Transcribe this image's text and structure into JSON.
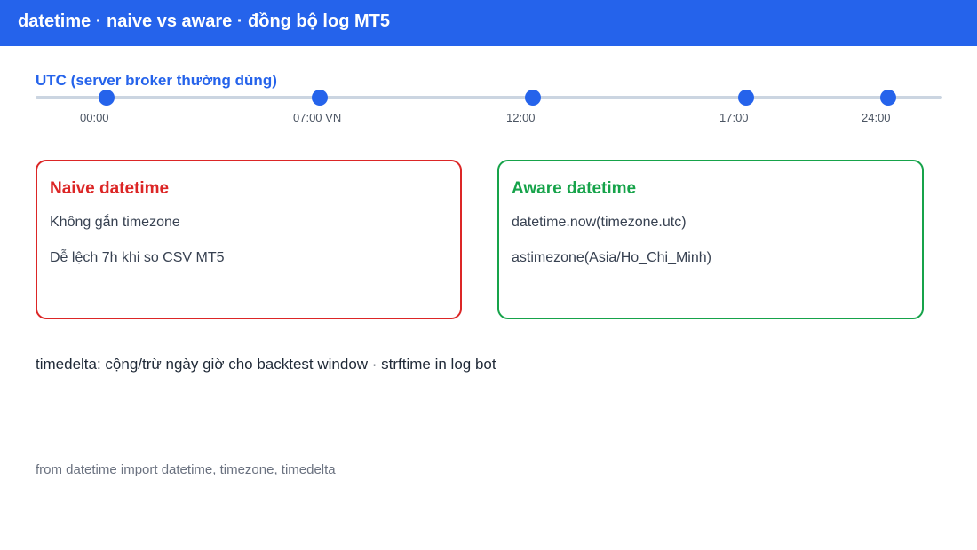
{
  "header": {
    "title": "datetime · naive vs aware · đồng bộ log MT5"
  },
  "timeline": {
    "title": "UTC (server broker thường dùng)",
    "ticks": [
      {
        "label": "00:00"
      },
      {
        "label": "07:00 VN"
      },
      {
        "label": "12:00"
      },
      {
        "label": "17:00"
      },
      {
        "label": "24:00"
      }
    ],
    "accent_color": "#2563eb"
  },
  "cards": {
    "naive": {
      "title": "Naive datetime",
      "lines": [
        "Không gắn timezone",
        "Dễ lệch 7h khi so CSV MT5"
      ],
      "color": "#dc2626"
    },
    "aware": {
      "title": "Aware datetime",
      "lines": [
        "datetime.now(timezone.utc)",
        "astimezone(Asia/Ho_Chi_Minh)"
      ],
      "color": "#16a34a"
    }
  },
  "summary": "timedelta: cộng/trừ ngày giờ cho backtest window · strftime in log bot",
  "footer": {
    "import_line": "from datetime import datetime, timezone, timedelta"
  }
}
